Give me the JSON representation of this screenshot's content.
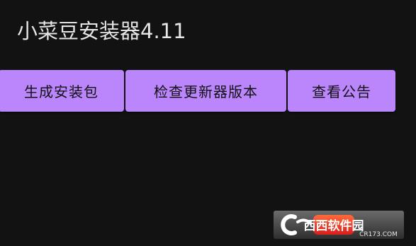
{
  "app": {
    "title": "小菜豆安装器4.11"
  },
  "toolbar": {
    "buttons": [
      {
        "label": "生成安装包"
      },
      {
        "label": "检查更新器版本"
      },
      {
        "label": "查看公告"
      }
    ]
  },
  "colors": {
    "background": "#131213",
    "button": "#bb86fc",
    "button_text": "#131213",
    "title_text": "#e6e6e6"
  },
  "watermark": {
    "text": "西西软件园",
    "subtext": "CR173.COM"
  }
}
